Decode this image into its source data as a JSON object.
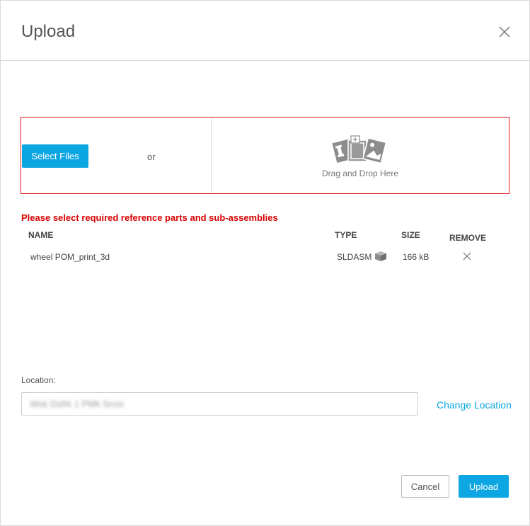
{
  "dialog": {
    "title": "Upload"
  },
  "dropzone": {
    "select_files_label": "Select Files",
    "or_text": "or",
    "drop_text": "Drag and Drop Here"
  },
  "warning": "Please select required reference parts and sub-assemblies",
  "table": {
    "columns": [
      "NAME",
      "TYPE",
      "SIZE",
      "REMOVE"
    ],
    "rows": [
      {
        "name": "wheel POM_print_3d",
        "type": "SLDASM",
        "size": "166 kB"
      }
    ]
  },
  "location": {
    "label": "Location:",
    "value": "Wsk Dsfrk 1 PMk Srvsr",
    "change_label": "Change Location"
  },
  "footer": {
    "cancel_label": "Cancel",
    "upload_label": "Upload"
  },
  "colors": {
    "accent": "#0ca6e2",
    "error": "#d90000",
    "dropzone_border": "#e31b23"
  },
  "icons": {
    "close": "close-icon",
    "drop": "image-files-icon",
    "type": "cube-icon",
    "remove": "remove-icon"
  }
}
